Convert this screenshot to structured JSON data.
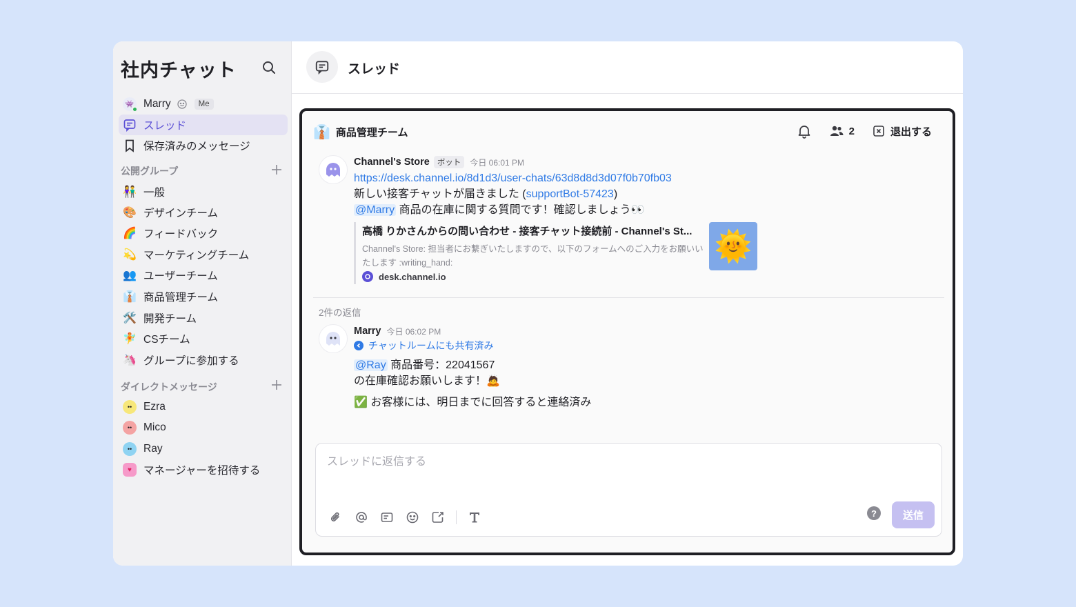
{
  "sidebar": {
    "title": "社内チャット",
    "me": {
      "name": "Marry",
      "badge": "Me"
    },
    "nav": [
      {
        "label": "スレッド",
        "icon": "thread-icon"
      },
      {
        "label": "保存済みのメッセージ",
        "icon": "bookmark-icon"
      }
    ],
    "groups_header": "公開グループ",
    "groups": [
      {
        "label": "一般",
        "emoji": "👫"
      },
      {
        "label": "デザインチーム",
        "emoji": "🎨"
      },
      {
        "label": "フィードバック",
        "emoji": "🌈"
      },
      {
        "label": "マーケティングチーム",
        "emoji": "💫"
      },
      {
        "label": "ユーザーチーム",
        "emoji": "👥"
      },
      {
        "label": "商品管理チーム",
        "emoji": "👔"
      },
      {
        "label": "開発チーム",
        "emoji": "🛠️"
      },
      {
        "label": "CSチーム",
        "emoji": "🧚"
      },
      {
        "label": "グループに参加する",
        "emoji": "🦄"
      }
    ],
    "dm_header": "ダイレクトメッセージ",
    "dms": [
      {
        "label": "Ezra",
        "color": "#f7e77a"
      },
      {
        "label": "Mico",
        "color": "#f4a3a3"
      },
      {
        "label": "Ray",
        "color": "#8fd3f2"
      },
      {
        "label": "マネージャーを招待する",
        "color": "#f69ac9"
      }
    ]
  },
  "header": {
    "title": "スレッド"
  },
  "thread": {
    "group_name": "商品管理チーム",
    "group_emoji": "👔",
    "member_count": "2",
    "leave_label": "退出する",
    "message": {
      "author": "Channel's Store",
      "tag": "ボット",
      "time": "今日 06:01 PM",
      "url": "https://desk.channel.io/8d1d3/user-chats/63d8d8d3d07f0b70fb03",
      "line2_prefix": "新しい接客チャットが届きました (",
      "line2_link": "supportBot-57423",
      "line2_suffix": ")",
      "mention": "@Marry",
      "line3": " 商品の在庫に関する質問です！確認しましょう👀",
      "preview": {
        "title": "高橋 りかさんからの問い合わせ - 接客チャット接続前 - Channel's St...",
        "desc": "Channel's Store: 担当者にお繋ぎいたしますので、以下のフォームへのご入力をお願いいたします :writing_hand:",
        "site": "desk.channel.io",
        "thumb": "🌞"
      }
    },
    "reply_count": "2件の返信",
    "reply": {
      "author": "Marry",
      "time": "今日 06:02 PM",
      "shared": "チャットルームにも共有済み",
      "mention": "@Ray",
      "line1": " 商品番号：22041567",
      "line2": "の在庫確認お願いします！🙇",
      "line3": "✅ お客様には、明日までに回答すると連絡済み"
    },
    "composer": {
      "placeholder": "スレッドに返信する",
      "send_label": "送信",
      "help": "?"
    }
  },
  "colors": {
    "accent": "#5b50d6",
    "link": "#2f7ae5",
    "send_disabled": "#c5c0f1",
    "background": "#d6e4fb"
  }
}
